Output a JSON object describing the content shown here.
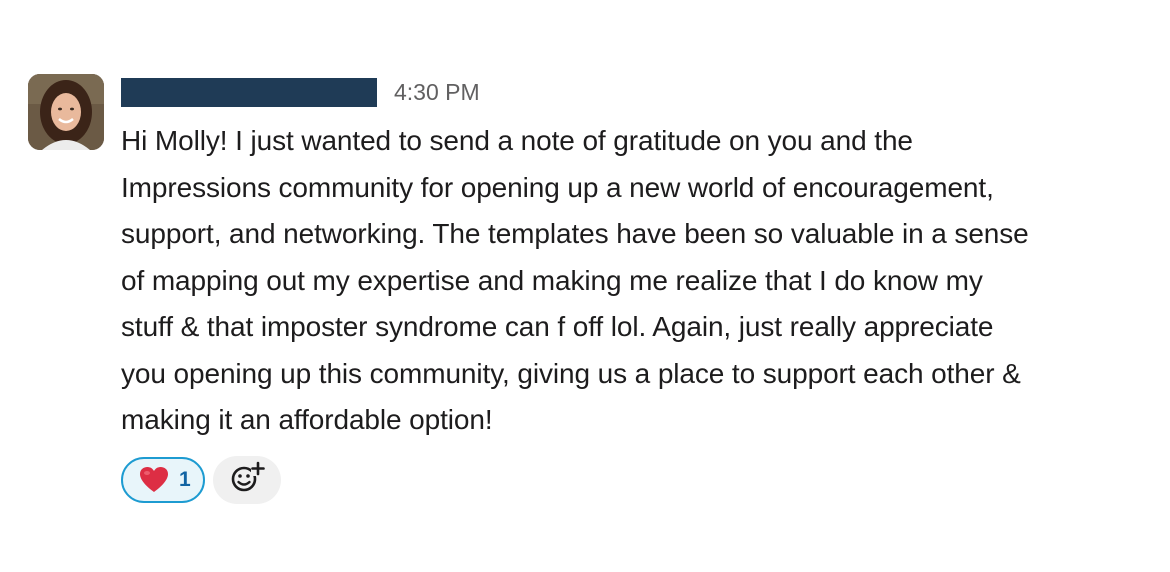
{
  "message": {
    "timestamp": "4:30 PM",
    "text": "Hi Molly! I just wanted to send a note of gratitude on you and the\nImpressions community for opening up a new world of encouragement,\nsupport, and networking. The templates have been so valuable in a sense\nof mapping out my expertise and making me realize that I do know my\nstuff & that imposter syndrome can f off lol. Again, just really appreciate\nyou opening up this community, giving us a place to support each other &\nmaking it an affordable option!"
  },
  "reactions": [
    {
      "emoji": "heart-icon",
      "count": "1"
    }
  ],
  "add_reaction": {
    "icon": "add-reaction-icon"
  },
  "colors": {
    "name_redaction": "#1f3b56",
    "reaction_border": "#1d9bd1",
    "reaction_bg": "#e8f5fa",
    "reaction_count": "#1264a3",
    "heart": "#dd2e44"
  }
}
